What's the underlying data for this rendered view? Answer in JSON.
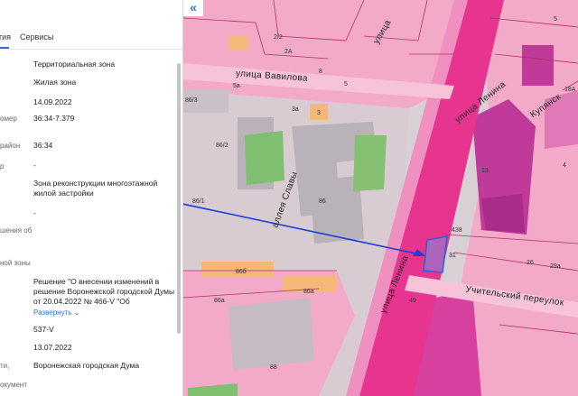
{
  "tabs": [
    {
      "label": "тия"
    },
    {
      "label": "Сервисы"
    }
  ],
  "rows": [
    {
      "label": "",
      "value": "Территориальная зона"
    },
    {
      "label": "",
      "value": "Жилая зона"
    },
    {
      "label": "",
      "value": "14.09.2022"
    },
    {
      "label": "омер",
      "value": "36:34-7.379"
    },
    {
      "label": "район",
      "value": "36:34"
    },
    {
      "label": "р",
      "value": "-"
    },
    {
      "label": "",
      "value": "Зона реконструкции многоэтажной жилой застройки"
    },
    {
      "label": "",
      "value": "-"
    },
    {
      "label": "шения об",
      "value": ""
    },
    {
      "label": "",
      "value": ""
    },
    {
      "label": "ной зоны",
      "value": ""
    },
    {
      "label": "",
      "value": "Решение \"О внесении изменений в решение Воронежской городской Думы от 20.04.2022 № 466-V \"Об"
    },
    {
      "label": "",
      "value": "537-V"
    },
    {
      "label": "",
      "value": "13.07.2022"
    },
    {
      "label": "ти,",
      "value": "Воронежская городская Дума"
    },
    {
      "label": "окумент",
      "value": ""
    }
  ],
  "expand_link": "Развернуть",
  "map": {
    "collapse_button": "«",
    "streets": {
      "vavilova": "улица Вавилова",
      "lenina_top": "улица Ленина",
      "lenina_bottom": "улица Ленина",
      "alley": "аллея Славы",
      "uchitelsky": "Учительский переулок",
      "kupyansky": "Купянск",
      "ulitsa_top": "улица"
    },
    "numbers": [
      "2/2",
      "2А",
      "8",
      "5",
      "3а",
      "3",
      "5а",
      "86/3",
      "86/2",
      "86",
      "86/1",
      "86б",
      "86а",
      "88",
      "86а",
      "31",
      "438",
      "49",
      "29а",
      "26",
      "18А",
      "13",
      "5",
      "4"
    ],
    "colors": {
      "zone_pink": "#f3aac9",
      "zone_dark": "#c03a9a",
      "road": "#e7348e",
      "arrow": "#1f3fd6",
      "highlight": "#4a7bd8"
    }
  }
}
